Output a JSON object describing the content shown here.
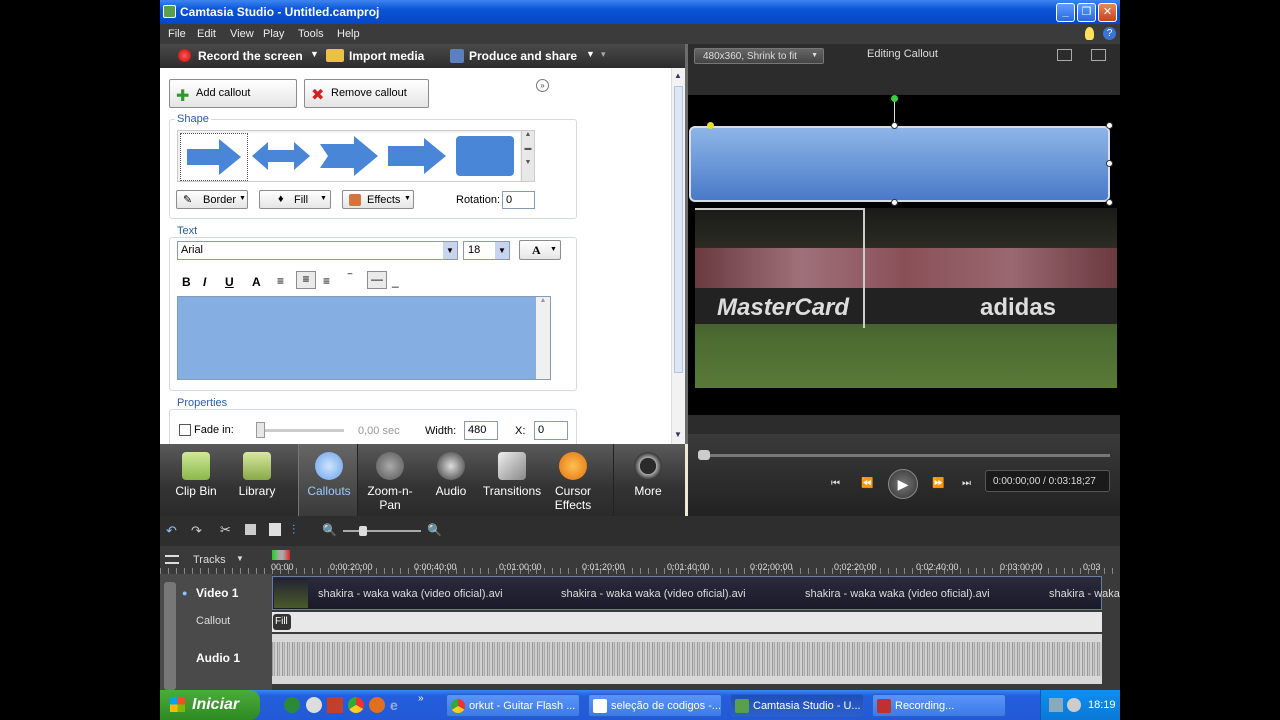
{
  "window": {
    "title": "Camtasia Studio - Untitled.camproj"
  },
  "menu": [
    "File",
    "Edit",
    "View",
    "Play",
    "Tools",
    "Help"
  ],
  "toolbar": {
    "record": "Record the screen",
    "import": "Import media",
    "produce": "Produce and share"
  },
  "callout_panel": {
    "add_button": "Add callout",
    "remove_button": "Remove callout",
    "shape_legend": "Shape",
    "border_button": "Border",
    "fill_button": "Fill",
    "effects_button": "Effects",
    "rotation_label": "Rotation:",
    "rotation_value": "0",
    "text_legend": "Text",
    "font_value": "Arial",
    "size_value": "18",
    "color_button": "A",
    "properties_legend": "Properties",
    "fade_label": "Fade in:",
    "fade_value": "0,00 sec",
    "width_label": "Width:",
    "width_value": "480",
    "x_label": "X:",
    "x_value": "0"
  },
  "preview": {
    "size_select": "480x360, Shrink to fit",
    "title": "Editing Callout",
    "time": "0:00:00;00 / 0:03:18;27"
  },
  "dock": {
    "items": [
      {
        "label": "Clip Bin",
        "icon": "clip-bin-icon"
      },
      {
        "label": "Library",
        "icon": "library-icon"
      },
      {
        "label": "Callouts",
        "icon": "callouts-icon"
      },
      {
        "label": "Zoom-n-Pan",
        "icon": "zoom-icon"
      },
      {
        "label": "Audio",
        "icon": "audio-icon"
      },
      {
        "label": "Transitions",
        "icon": "transitions-icon"
      },
      {
        "label": "Cursor Effects",
        "icon": "cursor-icon"
      },
      {
        "label": "More",
        "icon": "more-icon"
      }
    ]
  },
  "timeline": {
    "tracks_label": "Tracks",
    "ruler": [
      "00:00",
      "0:00:20;00",
      "0:00:40;00",
      "0:01:00;00",
      "0:01:20;00",
      "0:01:40;00",
      "0:02:00;00",
      "0:02:20;00",
      "0:02:40;00",
      "0:03:00;00",
      "0:03"
    ],
    "video_track": "Video 1",
    "callout_track": "Callout",
    "audio_track": "Audio 1",
    "callout_clip": "Fill",
    "clip_labels": [
      "shakira - waka waka (video oficial).avi",
      "shakira - waka waka (video oficial).avi",
      "shakira - waka waka (video oficial).avi",
      "shakira - waka"
    ]
  },
  "video": {
    "banner_text": "MasterCard",
    "banner_text2": "adidas"
  },
  "taskbar": {
    "start": "Iniciar",
    "tasks": [
      "orkut - Guitar Flash ...",
      "seleção de codigos -...",
      "Camtasia Studio - U...",
      "Recording..."
    ],
    "clock": "18:19"
  }
}
